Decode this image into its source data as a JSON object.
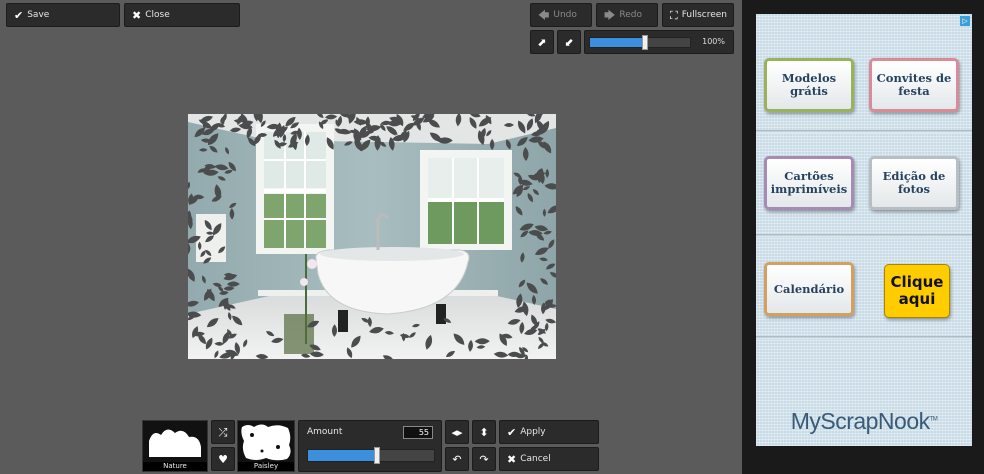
{
  "toolbar": {
    "save_label": "Save",
    "close_label": "Close",
    "undo_label": "Undo",
    "redo_label": "Redo",
    "fullscreen_label": "Fullscreen",
    "zoom_label": "100%",
    "zoom_value": 0.55
  },
  "effects": {
    "mask_left_caption": "Nature",
    "mask_right_caption": "Paisley",
    "amount_label": "Amount",
    "amount_value": "55",
    "amount_fraction": 0.55,
    "apply_label": "Apply",
    "cancel_label": "Cancel"
  },
  "ad": {
    "buttons": [
      {
        "label": "Modelos grátis"
      },
      {
        "label": "Convites de festa"
      },
      {
        "label": "Cartões imprimíveis"
      },
      {
        "label": "Edição de fotos"
      },
      {
        "label": "Calendário"
      },
      {
        "label": "Clique aqui"
      }
    ],
    "logo": "MyScrapNook",
    "logo_tm": "TM",
    "adchoice_glyph": "▷"
  },
  "colors": {
    "accent": "#3b8fdc",
    "background": "#5b5b5b",
    "button": "#2b2b2b"
  }
}
